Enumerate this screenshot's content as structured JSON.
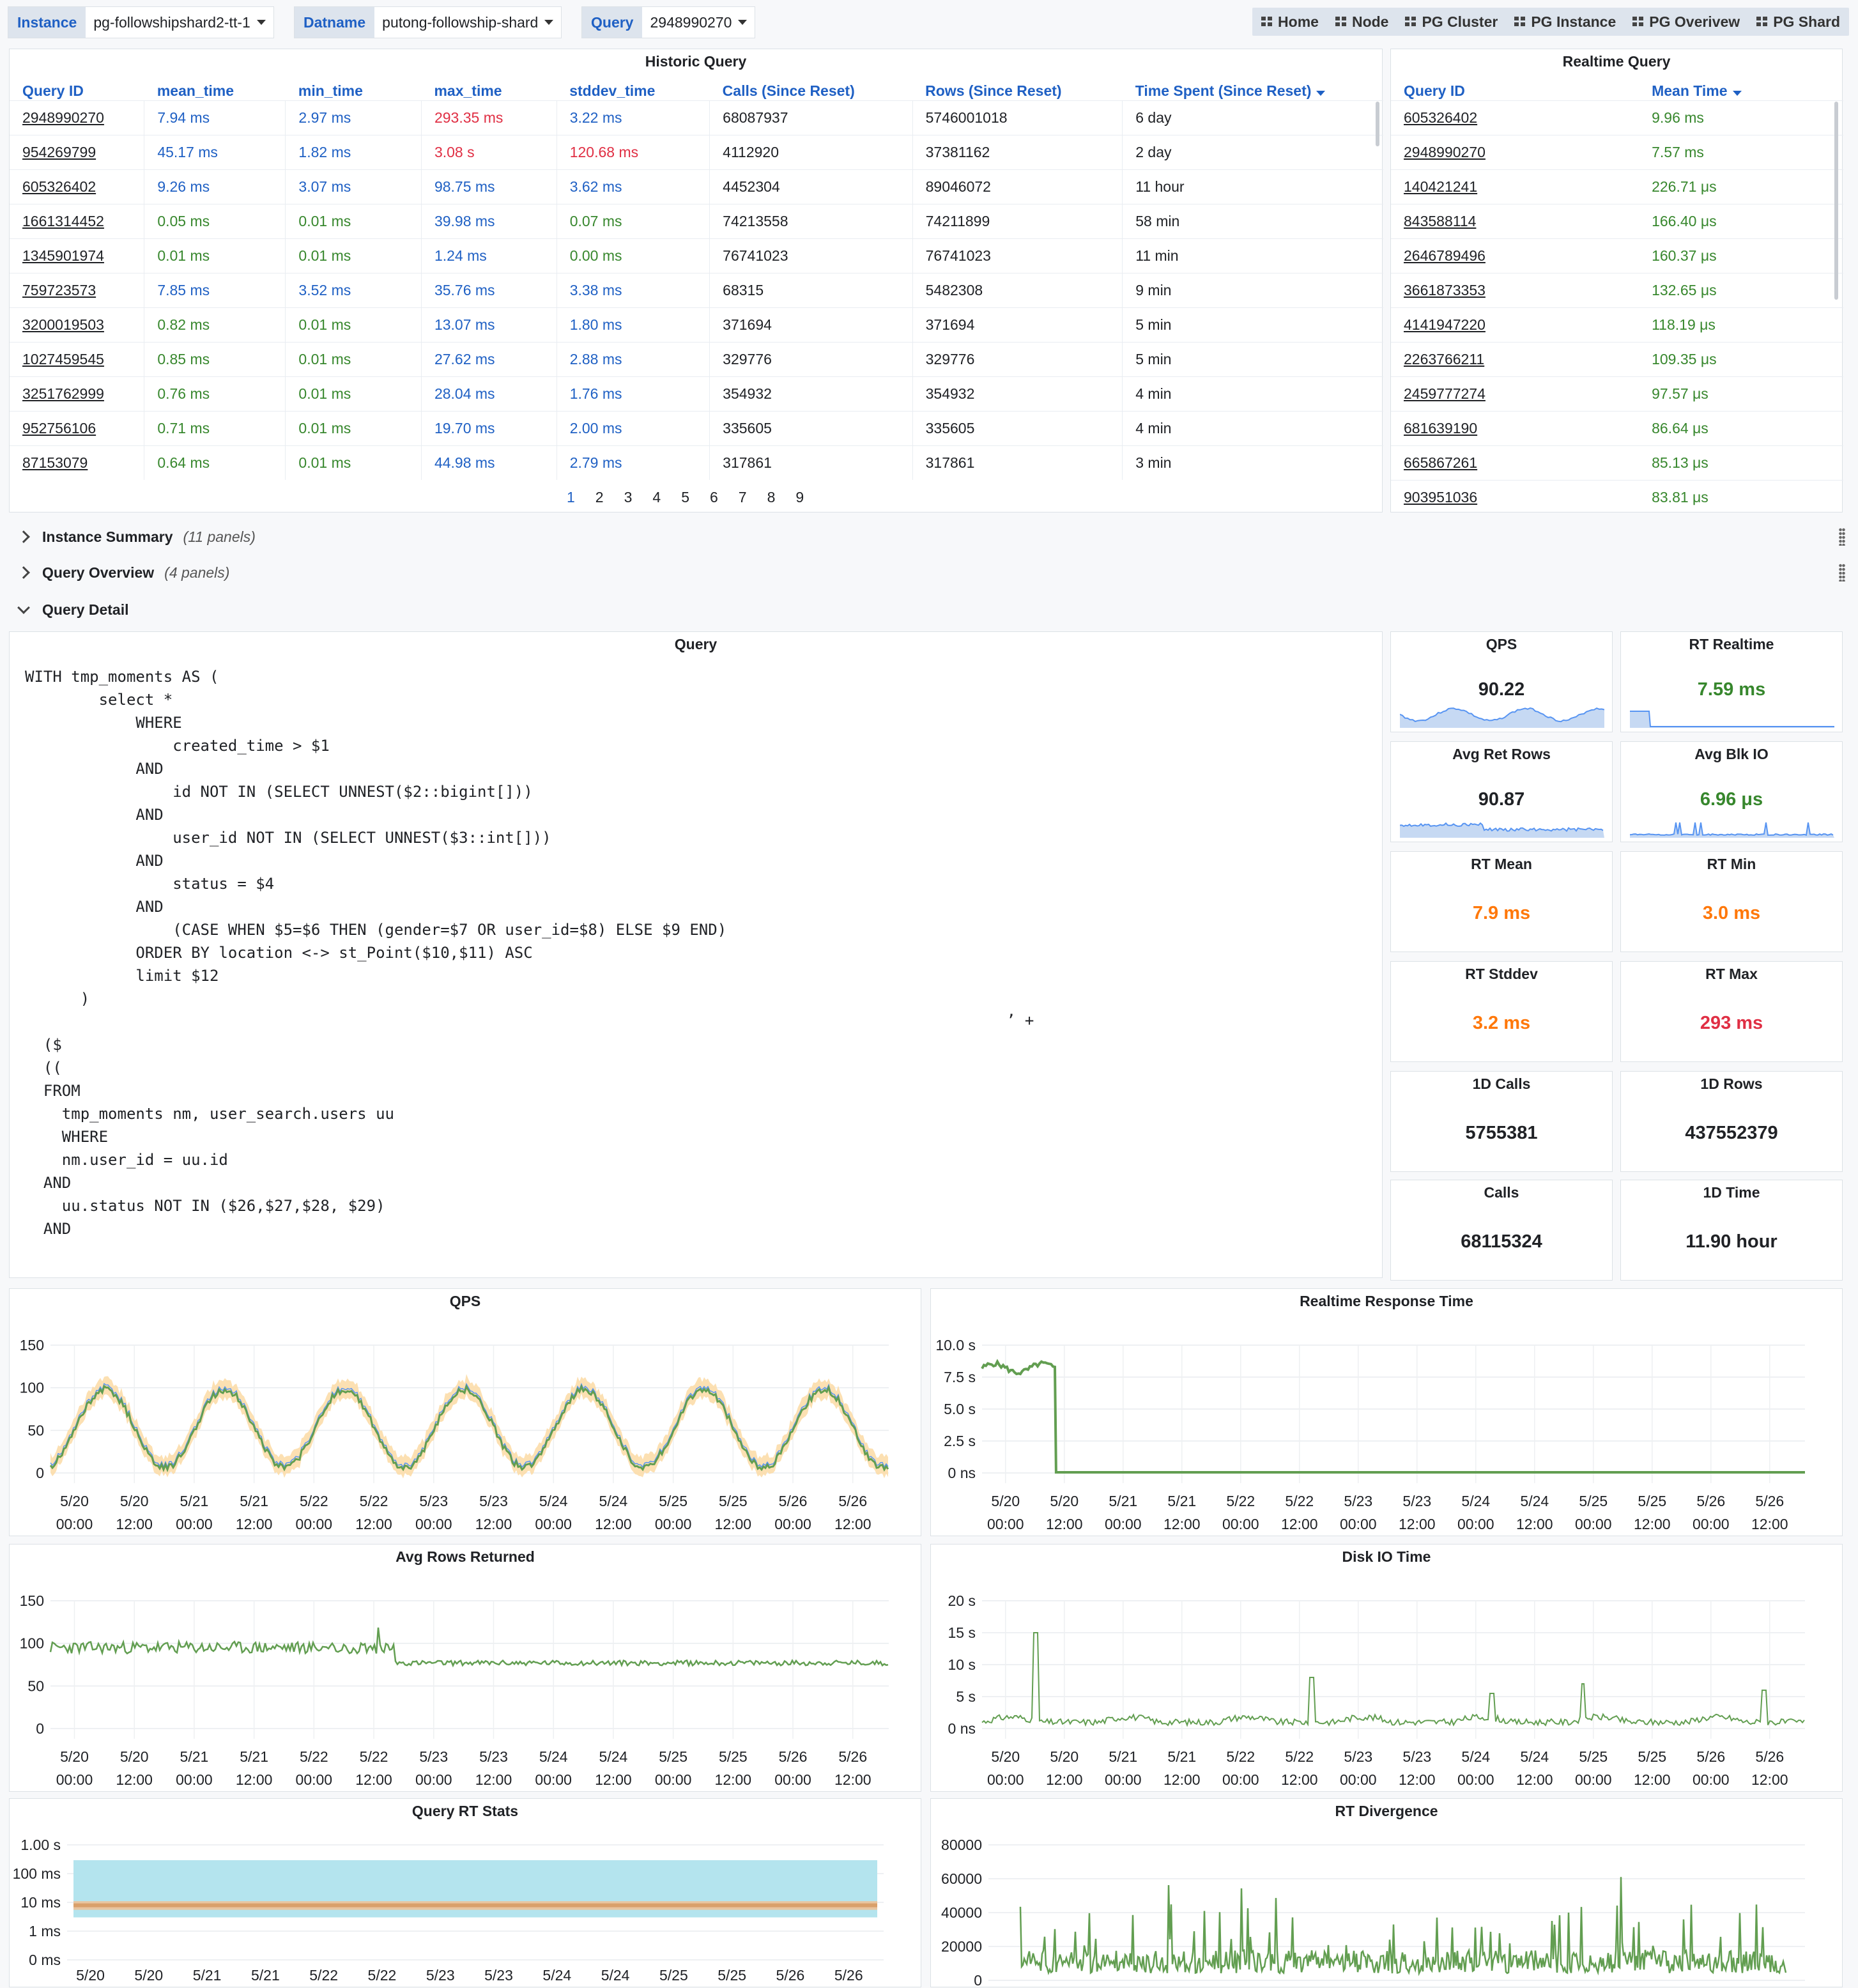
{
  "vars": [
    {
      "label": "Instance",
      "value": "pg-followshipshard2-tt-1"
    },
    {
      "label": "Datname",
      "value": "putong-followship-shard"
    },
    {
      "label": "Query",
      "value": "2948990270"
    }
  ],
  "links": [
    "Home",
    "Node",
    "PG Cluster",
    "PG Instance",
    "PG Overivew",
    "PG Shard"
  ],
  "historic": {
    "title": "Historic Query",
    "columns": [
      "Query ID",
      "mean_time",
      "min_time",
      "max_time",
      "stddev_time",
      "Calls (Since Reset)",
      "Rows (Since Reset)",
      "Time Spent (Since Reset)"
    ],
    "rows": [
      [
        "2948990270",
        "7.94 ms",
        "2.97 ms",
        "293.35 ms",
        "3.22 ms",
        "68087937",
        "5746001018",
        "6 day"
      ],
      [
        "954269799",
        "45.17 ms",
        "1.82 ms",
        "3.08 s",
        "120.68 ms",
        "4112920",
        "37381162",
        "2 day"
      ],
      [
        "605326402",
        "9.26 ms",
        "3.07 ms",
        "98.75 ms",
        "3.62 ms",
        "4452304",
        "89046072",
        "11 hour"
      ],
      [
        "1661314452",
        "0.05 ms",
        "0.01 ms",
        "39.98 ms",
        "0.07 ms",
        "74213558",
        "74211899",
        "58 min"
      ],
      [
        "1345901974",
        "0.01 ms",
        "0.01 ms",
        "1.24 ms",
        "0.00 ms",
        "76741023",
        "76741023",
        "11 min"
      ],
      [
        "759723573",
        "7.85 ms",
        "3.52 ms",
        "35.76 ms",
        "3.38 ms",
        "68315",
        "5482308",
        "9 min"
      ],
      [
        "3200019503",
        "0.82 ms",
        "0.01 ms",
        "13.07 ms",
        "1.80 ms",
        "371694",
        "371694",
        "5 min"
      ],
      [
        "1027459545",
        "0.85 ms",
        "0.01 ms",
        "27.62 ms",
        "2.88 ms",
        "329776",
        "329776",
        "5 min"
      ],
      [
        "3251762999",
        "0.76 ms",
        "0.01 ms",
        "28.04 ms",
        "1.76 ms",
        "354932",
        "354932",
        "4 min"
      ],
      [
        "952756106",
        "0.71 ms",
        "0.01 ms",
        "19.70 ms",
        "2.00 ms",
        "335605",
        "335605",
        "4 min"
      ],
      [
        "87153079",
        "0.64 ms",
        "0.01 ms",
        "44.98 ms",
        "2.79 ms",
        "317861",
        "317861",
        "3 min"
      ]
    ],
    "row_colors": [
      [
        "",
        "blue",
        "blue",
        "red",
        "blue",
        "",
        "",
        ""
      ],
      [
        "",
        "blue",
        "blue",
        "red",
        "red",
        "",
        "",
        ""
      ],
      [
        "",
        "blue",
        "blue",
        "blue",
        "blue",
        "",
        "",
        ""
      ],
      [
        "",
        "green",
        "green",
        "blue",
        "green",
        "",
        "",
        ""
      ],
      [
        "",
        "green",
        "green",
        "blue",
        "green",
        "",
        "",
        ""
      ],
      [
        "",
        "blue",
        "blue",
        "blue",
        "blue",
        "",
        "",
        ""
      ],
      [
        "",
        "green",
        "green",
        "blue",
        "blue",
        "",
        "",
        ""
      ],
      [
        "",
        "green",
        "green",
        "blue",
        "blue",
        "",
        "",
        ""
      ],
      [
        "",
        "green",
        "green",
        "blue",
        "blue",
        "",
        "",
        ""
      ],
      [
        "",
        "green",
        "green",
        "blue",
        "blue",
        "",
        "",
        ""
      ],
      [
        "",
        "green",
        "green",
        "blue",
        "blue",
        "",
        "",
        ""
      ]
    ],
    "pages": [
      "1",
      "2",
      "3",
      "4",
      "5",
      "6",
      "7",
      "8",
      "9"
    ]
  },
  "realtime": {
    "title": "Realtime Query",
    "columns": [
      "Query ID",
      "Mean Time"
    ],
    "rows": [
      [
        "605326402",
        "9.96 ms"
      ],
      [
        "2948990270",
        "7.57 ms"
      ],
      [
        "140421241",
        "226.71 μs"
      ],
      [
        "843588114",
        "166.40 μs"
      ],
      [
        "2646789496",
        "160.37 μs"
      ],
      [
        "3661873353",
        "132.65 μs"
      ],
      [
        "4141947220",
        "118.19 μs"
      ],
      [
        "2263766211",
        "109.35 μs"
      ],
      [
        "2459777274",
        "97.57 μs"
      ],
      [
        "681639190",
        "86.64 μs"
      ],
      [
        "665867261",
        "85.13 μs"
      ],
      [
        "903951036",
        "83.81 μs"
      ]
    ]
  },
  "rows_section": {
    "instance_summary": {
      "name": "Instance Summary",
      "count": "(11 panels)"
    },
    "query_overview": {
      "name": "Query Overview",
      "count": "(4 panels)"
    },
    "query_detail": {
      "name": "Query Detail"
    }
  },
  "query_panel": {
    "title": "Query",
    "text": "WITH tmp_moments AS (\n        select *\n            WHERE\n                created_time > $1\n            AND\n                id NOT IN (SELECT UNNEST($2::bigint[]))\n            AND\n                user_id NOT IN (SELECT UNNEST($3::int[]))\n            AND\n                status = $4\n            AND\n                (CASE WHEN $5=$6 THEN (gender=$7 OR user_id=$8) ELSE $9 END)\n            ORDER BY location <-> st_Point($10,$11) ASC\n            limit $12\n      )\n\n  ($\n  ((\n  FROM\n    tmp_moments nm, user_search.users uu\n    WHERE\n    nm.user_id = uu.id\n  AND\n    uu.status NOT IN ($26,$27,$28, $29)\n  AND",
    "stray": "’ +"
  },
  "stats": [
    {
      "title": "QPS",
      "value": "90.22",
      "color": "#202226",
      "spark": "qps"
    },
    {
      "title": "RT Realtime",
      "value": "7.59 ms",
      "color": "#37872d",
      "spark": "rt"
    },
    {
      "title": "Avg Ret Rows",
      "value": "90.87",
      "color": "#202226",
      "spark": "rows"
    },
    {
      "title": "Avg Blk IO",
      "value": "6.96 μs",
      "color": "#37872d",
      "spark": "io"
    },
    {
      "title": "RT Mean",
      "value": "7.9 ms",
      "color": "#ff780a",
      "spark": ""
    },
    {
      "title": "RT Min",
      "value": "3.0 ms",
      "color": "#ff780a",
      "spark": ""
    },
    {
      "title": "RT Stddev",
      "value": "3.2 ms",
      "color": "#ff780a",
      "spark": ""
    },
    {
      "title": "RT Max",
      "value": "293 ms",
      "color": "#e02f44",
      "spark": ""
    },
    {
      "title": "1D Calls",
      "value": "5755381",
      "color": "#202226",
      "spark": ""
    },
    {
      "title": "1D Rows",
      "value": "437552379",
      "color": "#202226",
      "spark": ""
    },
    {
      "title": "Calls",
      "value": "68115324",
      "color": "#202226",
      "spark": ""
    },
    {
      "title": "1D Time",
      "value": "11.90 hour",
      "color": "#202226",
      "spark": ""
    }
  ],
  "x_ticks": [
    [
      "5/20",
      "00:00"
    ],
    [
      "5/20",
      "12:00"
    ],
    [
      "5/21",
      "00:00"
    ],
    [
      "5/21",
      "12:00"
    ],
    [
      "5/22",
      "00:00"
    ],
    [
      "5/22",
      "12:00"
    ],
    [
      "5/23",
      "00:00"
    ],
    [
      "5/23",
      "12:00"
    ],
    [
      "5/24",
      "00:00"
    ],
    [
      "5/24",
      "12:00"
    ],
    [
      "5/25",
      "00:00"
    ],
    [
      "5/25",
      "12:00"
    ],
    [
      "5/26",
      "00:00"
    ],
    [
      "5/26",
      "12:00"
    ]
  ],
  "x_ticks_short": [
    "5/20",
    "5/20",
    "5/21",
    "5/21",
    "5/22",
    "5/22",
    "5/23",
    "5/23",
    "5/24",
    "5/24",
    "5/25",
    "5/25",
    "5/26",
    "5/26"
  ],
  "chart_data": [
    {
      "type": "line",
      "title": "QPS",
      "yticks": [
        "150",
        "100",
        "50",
        "0"
      ],
      "ylim": [
        0,
        150
      ],
      "pattern": "daily-cycle",
      "approx_peak": 100,
      "approx_trough": 5,
      "band_color": "#fcdba5",
      "color": "#629e51"
    },
    {
      "type": "line",
      "title": "Realtime Response Time",
      "yticks": [
        "10.0 s",
        "7.5 s",
        "5.0 s",
        "2.5 s",
        "0 ns"
      ],
      "ylim": [
        0,
        10
      ],
      "unit": "s",
      "approx_before_drop": 8.2,
      "drop_at": "5/20 12:00",
      "approx_after": 0.01,
      "color": "#629e51"
    },
    {
      "type": "line",
      "title": "Avg Rows Returned",
      "yticks": [
        "150",
        "100",
        "50",
        "0"
      ],
      "ylim": [
        0,
        150
      ],
      "approx_before": 95,
      "approx_after": 77,
      "drop_at": "5/22 12:00",
      "color": "#629e51"
    },
    {
      "type": "line",
      "title": "Disk IO Time",
      "yticks": [
        "20 s",
        "15 s",
        "10 s",
        "5 s",
        "0 ns"
      ],
      "ylim": [
        0,
        20
      ],
      "unit": "s",
      "approx_baseline": 0.8,
      "approx_peak": 15,
      "color": "#629e51"
    },
    {
      "type": "area",
      "title": "Query RT Stats",
      "yticks": [
        "1.00 s",
        "100 ms",
        "10 ms",
        "1 ms",
        "0 ms"
      ],
      "scale": "log",
      "band_max_ms": 293,
      "band_min_ms": 3,
      "mean_ms": 7.9,
      "colors": {
        "max": "#b4e4ee",
        "stddev": "#e8c5a0",
        "mean": "#d9a06b"
      }
    },
    {
      "type": "line",
      "title": "RT Divergence",
      "yticks": [
        "80000",
        "60000",
        "40000",
        "20000",
        "0"
      ],
      "ylim": [
        0,
        80000
      ],
      "approx_peak": 65000,
      "approx_baseline": 8000,
      "color": "#629e51"
    }
  ]
}
